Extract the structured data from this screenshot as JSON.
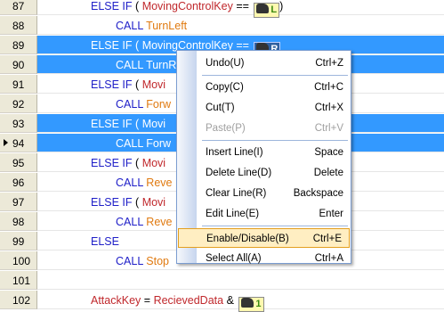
{
  "editor": {
    "rows": [
      {
        "num": "87",
        "selected": false,
        "current": false,
        "parts": [
          {
            "t": "ELSE IF",
            "c": "kw"
          },
          {
            "t": "(",
            "c": "op"
          },
          {
            "t": "MovingControlKey",
            "c": "id"
          },
          {
            "t": "==",
            "c": "op"
          },
          {
            "t": "L",
            "c": "icon"
          },
          {
            "t": ")",
            "c": "op"
          }
        ],
        "indent": 1
      },
      {
        "num": "88",
        "selected": false,
        "current": false,
        "parts": [
          {
            "t": "CALL",
            "c": "kw"
          },
          {
            "t": "TurnLeft",
            "c": "call"
          }
        ],
        "indent": 2
      },
      {
        "num": "89",
        "selected": true,
        "current": false,
        "parts": [
          {
            "t": "ELSE IF",
            "c": "kw"
          },
          {
            "t": "(",
            "c": "op"
          },
          {
            "t": "MovingControlKey",
            "c": "id"
          },
          {
            "t": "==",
            "c": "op"
          },
          {
            "t": "R",
            "c": "icon"
          }
        ],
        "indent": 1
      },
      {
        "num": "90",
        "selected": true,
        "current": false,
        "parts": [
          {
            "t": "CALL",
            "c": "kw"
          },
          {
            "t": "TurnR",
            "c": "call"
          }
        ],
        "indent": 2
      },
      {
        "num": "91",
        "selected": false,
        "current": false,
        "parts": [
          {
            "t": "ELSE IF",
            "c": "kw"
          },
          {
            "t": "(",
            "c": "op"
          },
          {
            "t": "Movi",
            "c": "id"
          }
        ],
        "indent": 1
      },
      {
        "num": "92",
        "selected": false,
        "current": false,
        "parts": [
          {
            "t": "CALL",
            "c": "kw"
          },
          {
            "t": "Forw",
            "c": "call"
          }
        ],
        "indent": 2
      },
      {
        "num": "93",
        "selected": true,
        "current": false,
        "parts": [
          {
            "t": "ELSE IF",
            "c": "kw"
          },
          {
            "t": "(",
            "c": "op"
          },
          {
            "t": "Movi",
            "c": "id"
          }
        ],
        "indent": 1
      },
      {
        "num": "94",
        "selected": true,
        "current": true,
        "parts": [
          {
            "t": "CALL",
            "c": "kw"
          },
          {
            "t": "Forw",
            "c": "call"
          }
        ],
        "indent": 2
      },
      {
        "num": "95",
        "selected": false,
        "current": false,
        "parts": [
          {
            "t": "ELSE IF",
            "c": "kw"
          },
          {
            "t": "(",
            "c": "op"
          },
          {
            "t": "Movi",
            "c": "id"
          }
        ],
        "indent": 1
      },
      {
        "num": "96",
        "selected": false,
        "current": false,
        "parts": [
          {
            "t": "CALL",
            "c": "kw"
          },
          {
            "t": "Reve",
            "c": "call"
          }
        ],
        "indent": 2
      },
      {
        "num": "97",
        "selected": false,
        "current": false,
        "parts": [
          {
            "t": "ELSE IF",
            "c": "kw"
          },
          {
            "t": "(",
            "c": "op"
          },
          {
            "t": "Movi",
            "c": "id"
          }
        ],
        "indent": 1
      },
      {
        "num": "98",
        "selected": false,
        "current": false,
        "parts": [
          {
            "t": "CALL",
            "c": "kw"
          },
          {
            "t": "Reve",
            "c": "call"
          }
        ],
        "indent": 2
      },
      {
        "num": "99",
        "selected": false,
        "current": false,
        "parts": [
          {
            "t": "ELSE",
            "c": "kw"
          }
        ],
        "indent": 1
      },
      {
        "num": "100",
        "selected": false,
        "current": false,
        "parts": [
          {
            "t": "CALL",
            "c": "kw"
          },
          {
            "t": "Stop",
            "c": "call"
          }
        ],
        "indent": 2
      },
      {
        "num": "101",
        "selected": false,
        "current": false,
        "parts": [],
        "indent": 1
      },
      {
        "num": "102",
        "selected": false,
        "current": false,
        "parts": [
          {
            "t": "AttackKey",
            "c": "id"
          },
          {
            "t": "=",
            "c": "op"
          },
          {
            "t": "RecievedData",
            "c": "id"
          },
          {
            "t": "&",
            "c": "op"
          },
          {
            "t": "1",
            "c": "icon"
          }
        ],
        "indent": 1
      }
    ]
  },
  "context_menu": {
    "items": [
      {
        "label": "Undo(U)",
        "shortcut": "Ctrl+Z",
        "enabled": true,
        "highlighted": false,
        "sep_after": true
      },
      {
        "label": "Copy(C)",
        "shortcut": "Ctrl+C",
        "enabled": true,
        "highlighted": false,
        "sep_after": false
      },
      {
        "label": "Cut(T)",
        "shortcut": "Ctrl+X",
        "enabled": true,
        "highlighted": false,
        "sep_after": false
      },
      {
        "label": "Paste(P)",
        "shortcut": "Ctrl+V",
        "enabled": false,
        "highlighted": false,
        "sep_after": true
      },
      {
        "label": "Insert Line(I)",
        "shortcut": "Space",
        "enabled": true,
        "highlighted": false,
        "sep_after": false
      },
      {
        "label": "Delete Line(D)",
        "shortcut": "Delete",
        "enabled": true,
        "highlighted": false,
        "sep_after": false
      },
      {
        "label": "Clear Line(R)",
        "shortcut": "Backspace",
        "enabled": true,
        "highlighted": false,
        "sep_after": false
      },
      {
        "label": "Edit Line(E)",
        "shortcut": "Enter",
        "enabled": true,
        "highlighted": false,
        "sep_after": true
      },
      {
        "label": "Enable/Disable(B)",
        "shortcut": "Ctrl+E",
        "enabled": true,
        "highlighted": true,
        "sep_after": false
      },
      {
        "label": "Select All(A)",
        "shortcut": "Ctrl+A",
        "enabled": true,
        "highlighted": false,
        "sep_after": false
      }
    ]
  },
  "colors": {
    "selection": "#3399ff",
    "keyword": "#2020c8",
    "identifier": "#c0282c",
    "call_target": "#e07a10",
    "menu_highlight": "#ffeec2"
  }
}
